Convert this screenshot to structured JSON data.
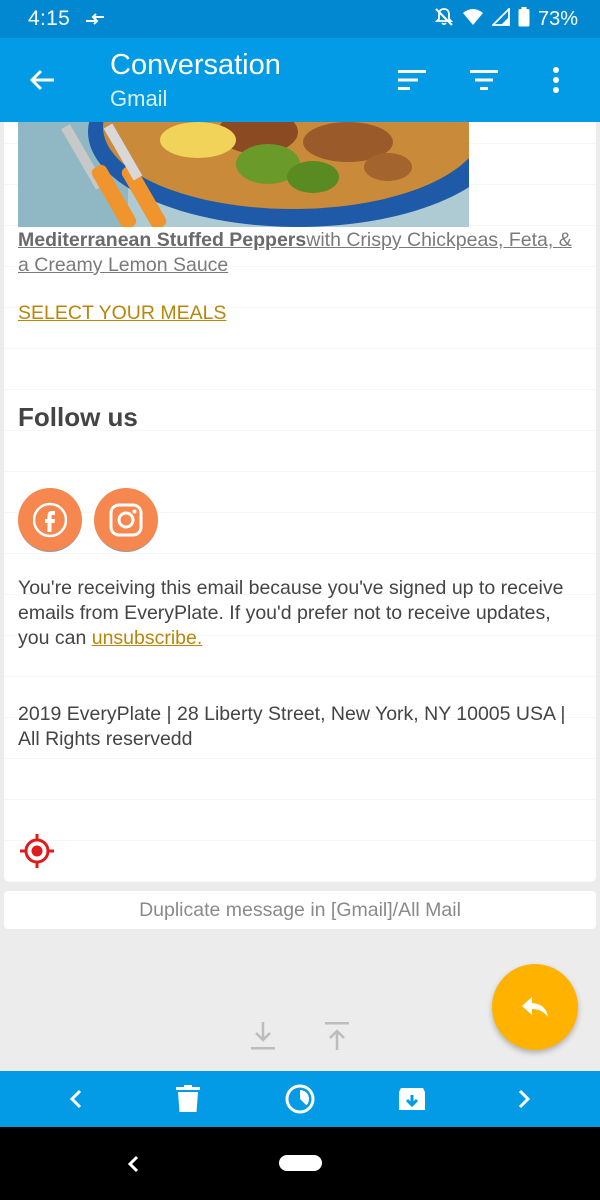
{
  "status_bar": {
    "time": "4:15",
    "battery": "73%"
  },
  "app_bar": {
    "title": "Conversation",
    "subtitle": "Gmail"
  },
  "email": {
    "recipe_title": "Mediterranean Stuffed Peppers",
    "recipe_desc": "with Crispy Chickpeas, Feta, & a Creamy Lemon Sauce ",
    "select_meals": "SELECT YOUR MEALS ",
    "follow_heading": "Follow us",
    "legal_text": "You're receiving this email because you've signed up to receive emails from EveryPlate. If you'd prefer not to receive updates, you can ",
    "unsubscribe": "unsubscribe.",
    "address": "2019 EveryPlate  |   28 Liberty Street, New York, NY 10005 USA  |   All Rights reservedd"
  },
  "duplicate_notice": "Duplicate message in [Gmail]/All Mail",
  "colors": {
    "status_bar": "#0288d1",
    "app_bar": "#039be5",
    "fab": "#ffb300",
    "social_orange": "#f5874f",
    "link_gold": "#b8860b"
  },
  "icons": {
    "social": [
      "facebook-icon",
      "instagram-icon"
    ],
    "bottom_bar": [
      "chevron-left-icon",
      "trash-icon",
      "snooze-icon",
      "archive-icon",
      "chevron-right-icon"
    ]
  }
}
